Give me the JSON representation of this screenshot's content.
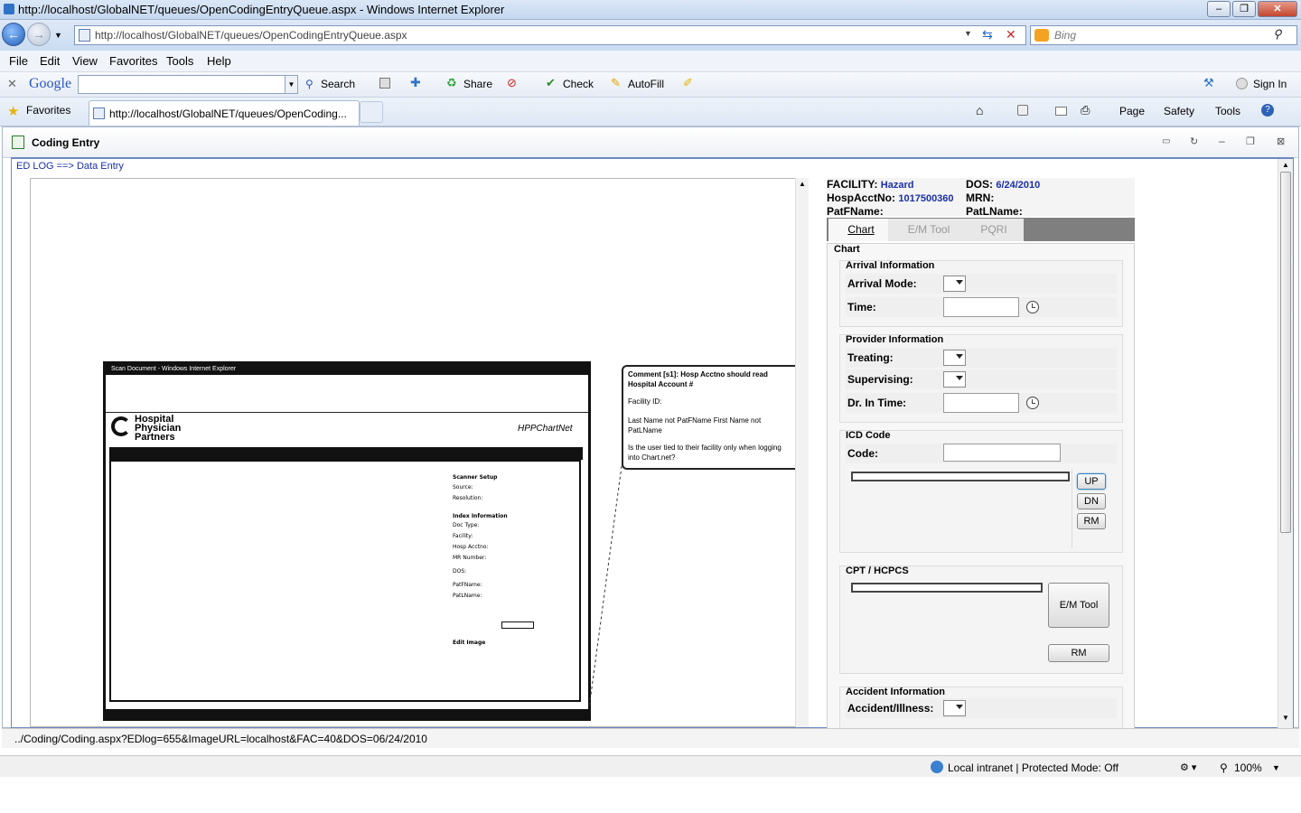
{
  "window": {
    "title": "http://localhost/GlobalNET/queues/OpenCodingEntryQueue.aspx - Windows Internet Explorer",
    "address": "http://localhost/GlobalNET/queues/OpenCodingEntryQueue.aspx",
    "search_placeholder": "Bing"
  },
  "menu": [
    "File",
    "Edit",
    "View",
    "Favorites",
    "Tools",
    "Help"
  ],
  "google_bar": {
    "logo": "Google",
    "search": "Search",
    "share": "Share",
    "check": "Check",
    "autofill": "AutoFill",
    "signin": "Sign In"
  },
  "favorites_bar": {
    "favorites": "Favorites",
    "tab_title": "http://localhost/GlobalNET/queues/OpenCoding...",
    "page": "Page",
    "safety": "Safety",
    "tools": "Tools"
  },
  "portlet": {
    "title": "Coding Entry",
    "breadcrumb": "ED LOG ==> Data Entry"
  },
  "scan": {
    "title": "Scan Document - Windows Internet Explorer",
    "brand": "Hospital Physician Partners",
    "app": "HPPChartNet",
    "labels": [
      "Scanner Setup",
      "Source:",
      "Resolution:",
      "Index Information",
      "Doc Type:",
      "Facility:",
      "Hosp Acctno:",
      "MR Number:",
      "DOS:",
      "PatFName:",
      "PatLName:",
      "Edit Image"
    ],
    "comment": "Comment [s1]: Hosp Acctno should read Hospital Account #",
    "comment2": "Facility ID:",
    "comment3": "Last Name not PatFName First Name not PatLName",
    "comment4": "Is the user tied to their facility only when logging into Chart.net?"
  },
  "header": {
    "facility_label": "FACILITY:",
    "facility_value": "Hazard",
    "dos_label": "DOS:",
    "dos_value": "6/24/2010",
    "acct_label": "HospAcctNo:",
    "acct_value": "1017500360",
    "mrn_label": "MRN:",
    "patf_label": "PatFName:",
    "patl_label": "PatLName:"
  },
  "tabs": [
    "Chart",
    "E/M Tool",
    "PQRI"
  ],
  "chart": {
    "title": "Chart",
    "arrival": {
      "title": "Arrival Information",
      "mode": "Arrival Mode:",
      "time": "Time:"
    },
    "provider": {
      "title": "Provider Information",
      "treating": "Treating:",
      "supervising": "Supervising:",
      "drtime": "Dr. In Time:"
    },
    "icd": {
      "title": "ICD Code",
      "code": "Code:",
      "up": "UP",
      "dn": "DN",
      "rm": "RM"
    },
    "cpt": {
      "title": "CPT / HCPCS",
      "em": "E/M Tool",
      "rm": "RM"
    },
    "accident": {
      "title": "Accident Information",
      "illness": "Accident/Illness:"
    }
  },
  "url_status": "../Coding/Coding.aspx?EDlog=655&ImageURL=localhost&FAC=40&DOS=06/24/2010",
  "status": {
    "zone": "Local intranet | Protected Mode: Off",
    "zoom": "100%"
  }
}
